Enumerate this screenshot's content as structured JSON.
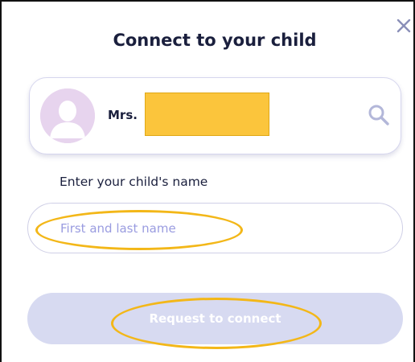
{
  "dialog": {
    "title": "Connect to your child",
    "close_icon": "close-icon"
  },
  "teacher": {
    "name_prefix": "Mrs. ",
    "avatar_icon": "person-avatar-icon",
    "search_icon": "search-icon",
    "redaction_color": "#fbc53c"
  },
  "child_name": {
    "label": "Enter your child's name",
    "placeholder": "First and last name",
    "value": ""
  },
  "submit": {
    "label": "Request to connect",
    "disabled": true
  },
  "annotations": {
    "highlight_color": "#f3b718"
  },
  "colors": {
    "title": "#1a1f3d",
    "placeholder": "#9a9ce0",
    "button_disabled_bg": "#d7daf1",
    "avatar_bg": "#e7d4ee"
  }
}
